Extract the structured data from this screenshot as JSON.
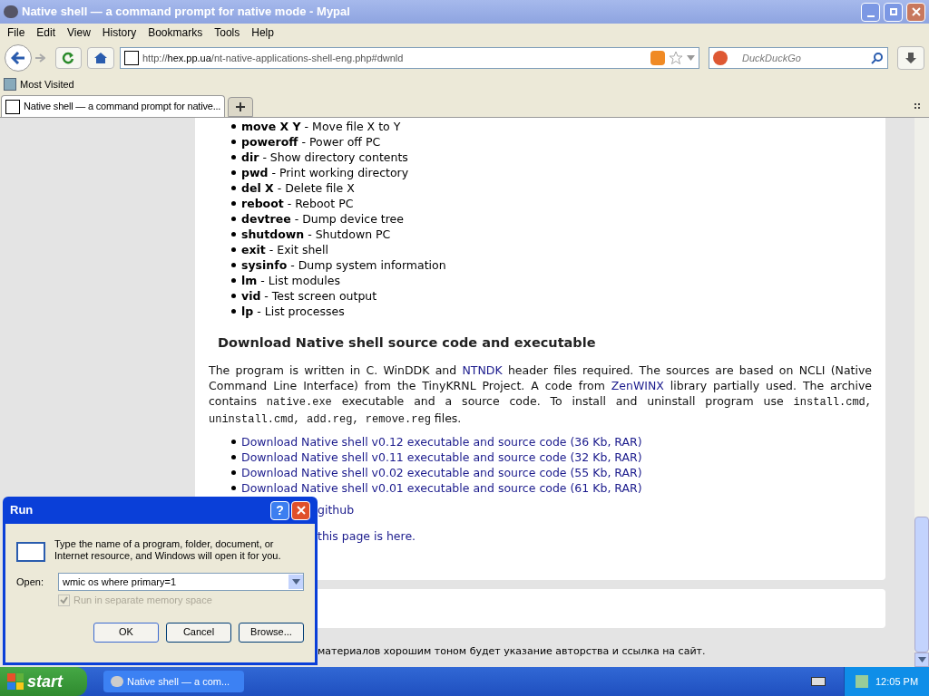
{
  "window": {
    "title": "Native shell — a command prompt for native mode - Mypal"
  },
  "menu": [
    "File",
    "Edit",
    "View",
    "History",
    "Bookmarks",
    "Tools",
    "Help"
  ],
  "address": {
    "prefix": "http://",
    "host": "hex.pp.ua",
    "path": "/nt-native-applications-shell-eng.php#dwnld"
  },
  "search": {
    "placeholder": "DuckDuckGo"
  },
  "bookmarks": [
    "Most Visited"
  ],
  "tabs": [
    {
      "label": "Native shell — a command prompt for native...",
      "selected": true
    }
  ],
  "commands": [
    {
      "cmd": "move X Y",
      "desc": " - Move file X to Y"
    },
    {
      "cmd": "poweroff",
      "desc": " - Power off PC"
    },
    {
      "cmd": "dir",
      "desc": " - Show directory contents"
    },
    {
      "cmd": "pwd",
      "desc": " - Print working directory"
    },
    {
      "cmd": "del X",
      "desc": " - Delete file X"
    },
    {
      "cmd": "reboot",
      "desc": " - Reboot PC"
    },
    {
      "cmd": "devtree",
      "desc": " - Dump device tree"
    },
    {
      "cmd": "shutdown",
      "desc": " - Shutdown PC"
    },
    {
      "cmd": "exit",
      "desc": " - Exit shell"
    },
    {
      "cmd": "sysinfo",
      "desc": " - Dump system information"
    },
    {
      "cmd": "lm",
      "desc": " - List modules"
    },
    {
      "cmd": "vid",
      "desc": " - Test screen output"
    },
    {
      "cmd": "lp",
      "desc": " - List processes"
    }
  ],
  "heading": "Download Native shell source code and executable",
  "paragraph": [
    {
      "kind": "text",
      "text": "The program is written in C. WinDDK and "
    },
    {
      "kind": "link",
      "text": "NTNDK"
    },
    {
      "kind": "text",
      "text": " header files required. The sources are based on NCLI (Native Command Line Interface) from the TinyKRNL Project. A code from "
    },
    {
      "kind": "link",
      "text": "ZenWINX"
    },
    {
      "kind": "text",
      "text": " library partially used. The archive contains "
    },
    {
      "kind": "code",
      "text": "native.exe"
    },
    {
      "kind": "text",
      "text": " executable and a source code. To install and uninstall program use "
    },
    {
      "kind": "code",
      "text": "install.cmd, uninstall.cmd, add.reg, remove.reg"
    },
    {
      "kind": "text",
      "text": " files."
    }
  ],
  "downloads": [
    "Download Native shell v0.12 executable and source code (36 Kb, RAR)",
    "Download Native shell v0.11 executable and source code (32 Kb, RAR)",
    "Download Native shell v0.02 executable and source code (55 Kb, RAR)",
    "Download Native shell v0.01 executable and source code (61 Kb, RAR)"
  ],
  "partial_links": [
    "github",
    "this page is here."
  ],
  "footer": "материалов хорошим тоном будет указание авторства и ссылка на сайт.",
  "run_dialog": {
    "title": "Run",
    "help_label": "?",
    "message": "Type the name of a program, folder, document, or Internet resource, and Windows will open it for you.",
    "open_label": "Open:",
    "value": "wmic os where primary=1",
    "checkbox": {
      "label": "Run in separate memory space",
      "checked": true,
      "disabled": true
    },
    "buttons": [
      "OK",
      "Cancel",
      "Browse..."
    ]
  },
  "taskbar": {
    "start": "start",
    "tasks": [
      {
        "label": "Native shell — a com...",
        "selected": false
      }
    ],
    "clock": "12:05 PM"
  }
}
